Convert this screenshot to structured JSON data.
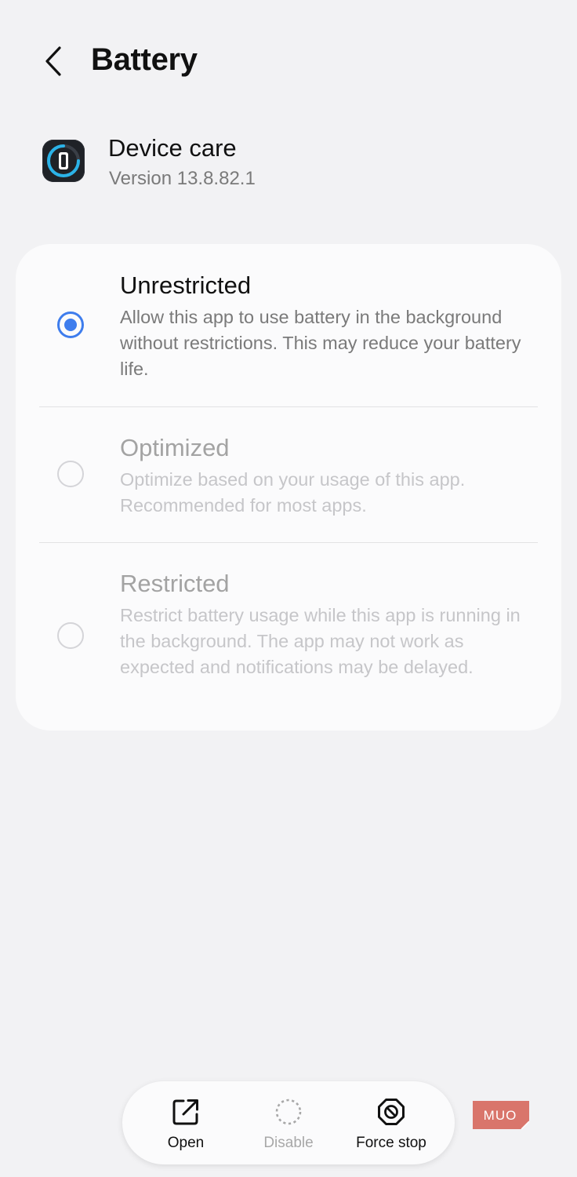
{
  "header": {
    "title": "Battery",
    "back_icon": "chevron-left-icon"
  },
  "app": {
    "name": "Device care",
    "version": "Version 13.8.82.1",
    "icon": "device-care-icon"
  },
  "options": [
    {
      "title": "Unrestricted",
      "description": "Allow this app to use battery in the background without restrictions. This may reduce your battery life.",
      "selected": true
    },
    {
      "title": "Optimized",
      "description": "Optimize based on your usage of this app. Recommended for most apps.",
      "selected": false
    },
    {
      "title": "Restricted",
      "description": "Restrict battery usage while this app is running in the background. The app may not work as expected and notifications may be delayed.",
      "selected": false
    }
  ],
  "actions": {
    "open_label": "Open",
    "disable_label": "Disable",
    "force_stop_label": "Force stop"
  },
  "watermark": {
    "text": "MUO"
  },
  "colors": {
    "accent": "#3e7ded",
    "background": "#f2f2f4",
    "card": "#fbfbfc",
    "watermark": "#d9756b"
  }
}
